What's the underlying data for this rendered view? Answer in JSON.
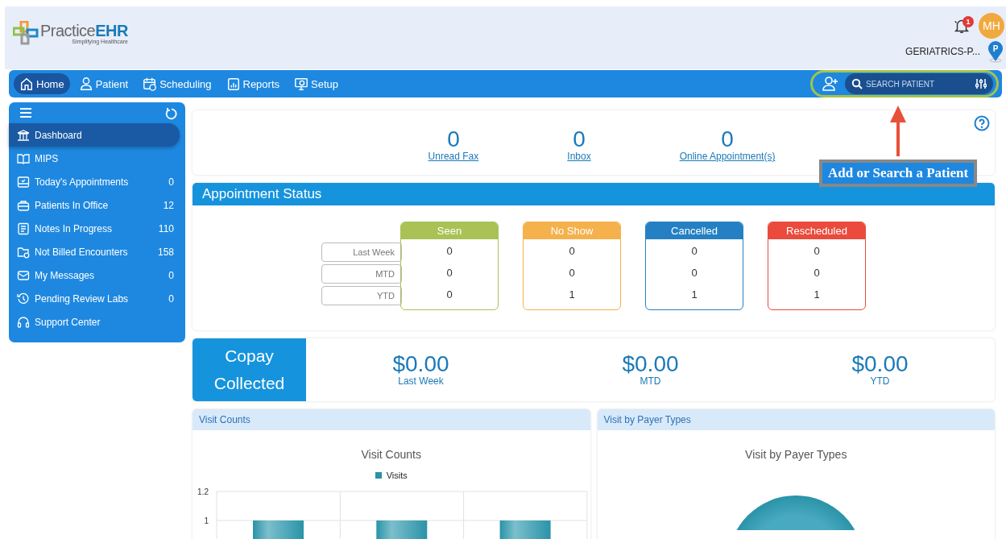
{
  "header": {
    "logo": {
      "name": "Practice",
      "accent": "EHR",
      "tagline": "Simplifying Healthcare"
    },
    "notifications": "1",
    "avatar": "MH",
    "location": "GERIATRICS-P...",
    "pin_label": "P"
  },
  "nav": {
    "tabs": [
      {
        "label": "Home",
        "selected": true
      },
      {
        "label": "Patient",
        "selected": false
      },
      {
        "label": "Scheduling",
        "selected": false
      },
      {
        "label": "Reports",
        "selected": false
      },
      {
        "label": "Setup",
        "selected": false
      }
    ],
    "search": {
      "placeholder": "SEARCH PATIENT"
    }
  },
  "sidebar": {
    "items": [
      {
        "label": "Dashboard",
        "selected": true
      },
      {
        "label": "MIPS",
        "selected": false
      },
      {
        "label": "Today's Appointments",
        "count": "0",
        "selected": false
      },
      {
        "label": "Patients In Office",
        "count": "12",
        "selected": false
      },
      {
        "label": "Notes In Progress",
        "count": "110",
        "selected": false
      },
      {
        "label": "Not Billed Encounters",
        "count": "158",
        "selected": false
      },
      {
        "label": "My Messages",
        "count": "0",
        "selected": false
      },
      {
        "label": "Pending Review Labs",
        "count": "0",
        "selected": false
      },
      {
        "label": "Support Center",
        "selected": false
      }
    ]
  },
  "stats": [
    {
      "value": "0",
      "label": "Unread Fax"
    },
    {
      "value": "0",
      "label": "Inbox"
    },
    {
      "value": "0",
      "label": "Online Appointment(s)"
    }
  ],
  "annotation": {
    "text": "Add or Search a Patient"
  },
  "appointment_status": {
    "title": "Appointment Status",
    "rows": [
      "Last Week",
      "MTD",
      "YTD"
    ],
    "columns": [
      {
        "title": "Seen",
        "color": "#a8c256",
        "values": [
          "0",
          "0",
          "0"
        ]
      },
      {
        "title": "No Show",
        "color": "#f5b14c",
        "values": [
          "0",
          "0",
          "1"
        ]
      },
      {
        "title": "Cancelled",
        "color": "#2580c3",
        "values": [
          "0",
          "0",
          "1"
        ]
      },
      {
        "title": "Rescheduled",
        "color": "#ea4b3c",
        "values": [
          "0",
          "0",
          "1"
        ]
      }
    ]
  },
  "copay": {
    "title_lines": [
      "Copay",
      "Collected"
    ],
    "amounts": [
      {
        "value": "$0.00",
        "label": "Last Week"
      },
      {
        "value": "$0.00",
        "label": "MTD"
      },
      {
        "value": "$0.00",
        "label": "YTD"
      }
    ]
  },
  "panels": [
    {
      "header": "Visit Counts",
      "chart_data": {
        "type": "bar",
        "title": "Visit Counts",
        "series": [
          {
            "name": "Visits",
            "color": "#2a93a8",
            "values": [
              1,
              1,
              1
            ]
          }
        ],
        "ylim": [
          0,
          1.2
        ],
        "yticks": [
          1,
          1.2
        ]
      }
    },
    {
      "header": "Visit by Payer Types",
      "chart_title": "Visit by Payer Types"
    }
  ]
}
